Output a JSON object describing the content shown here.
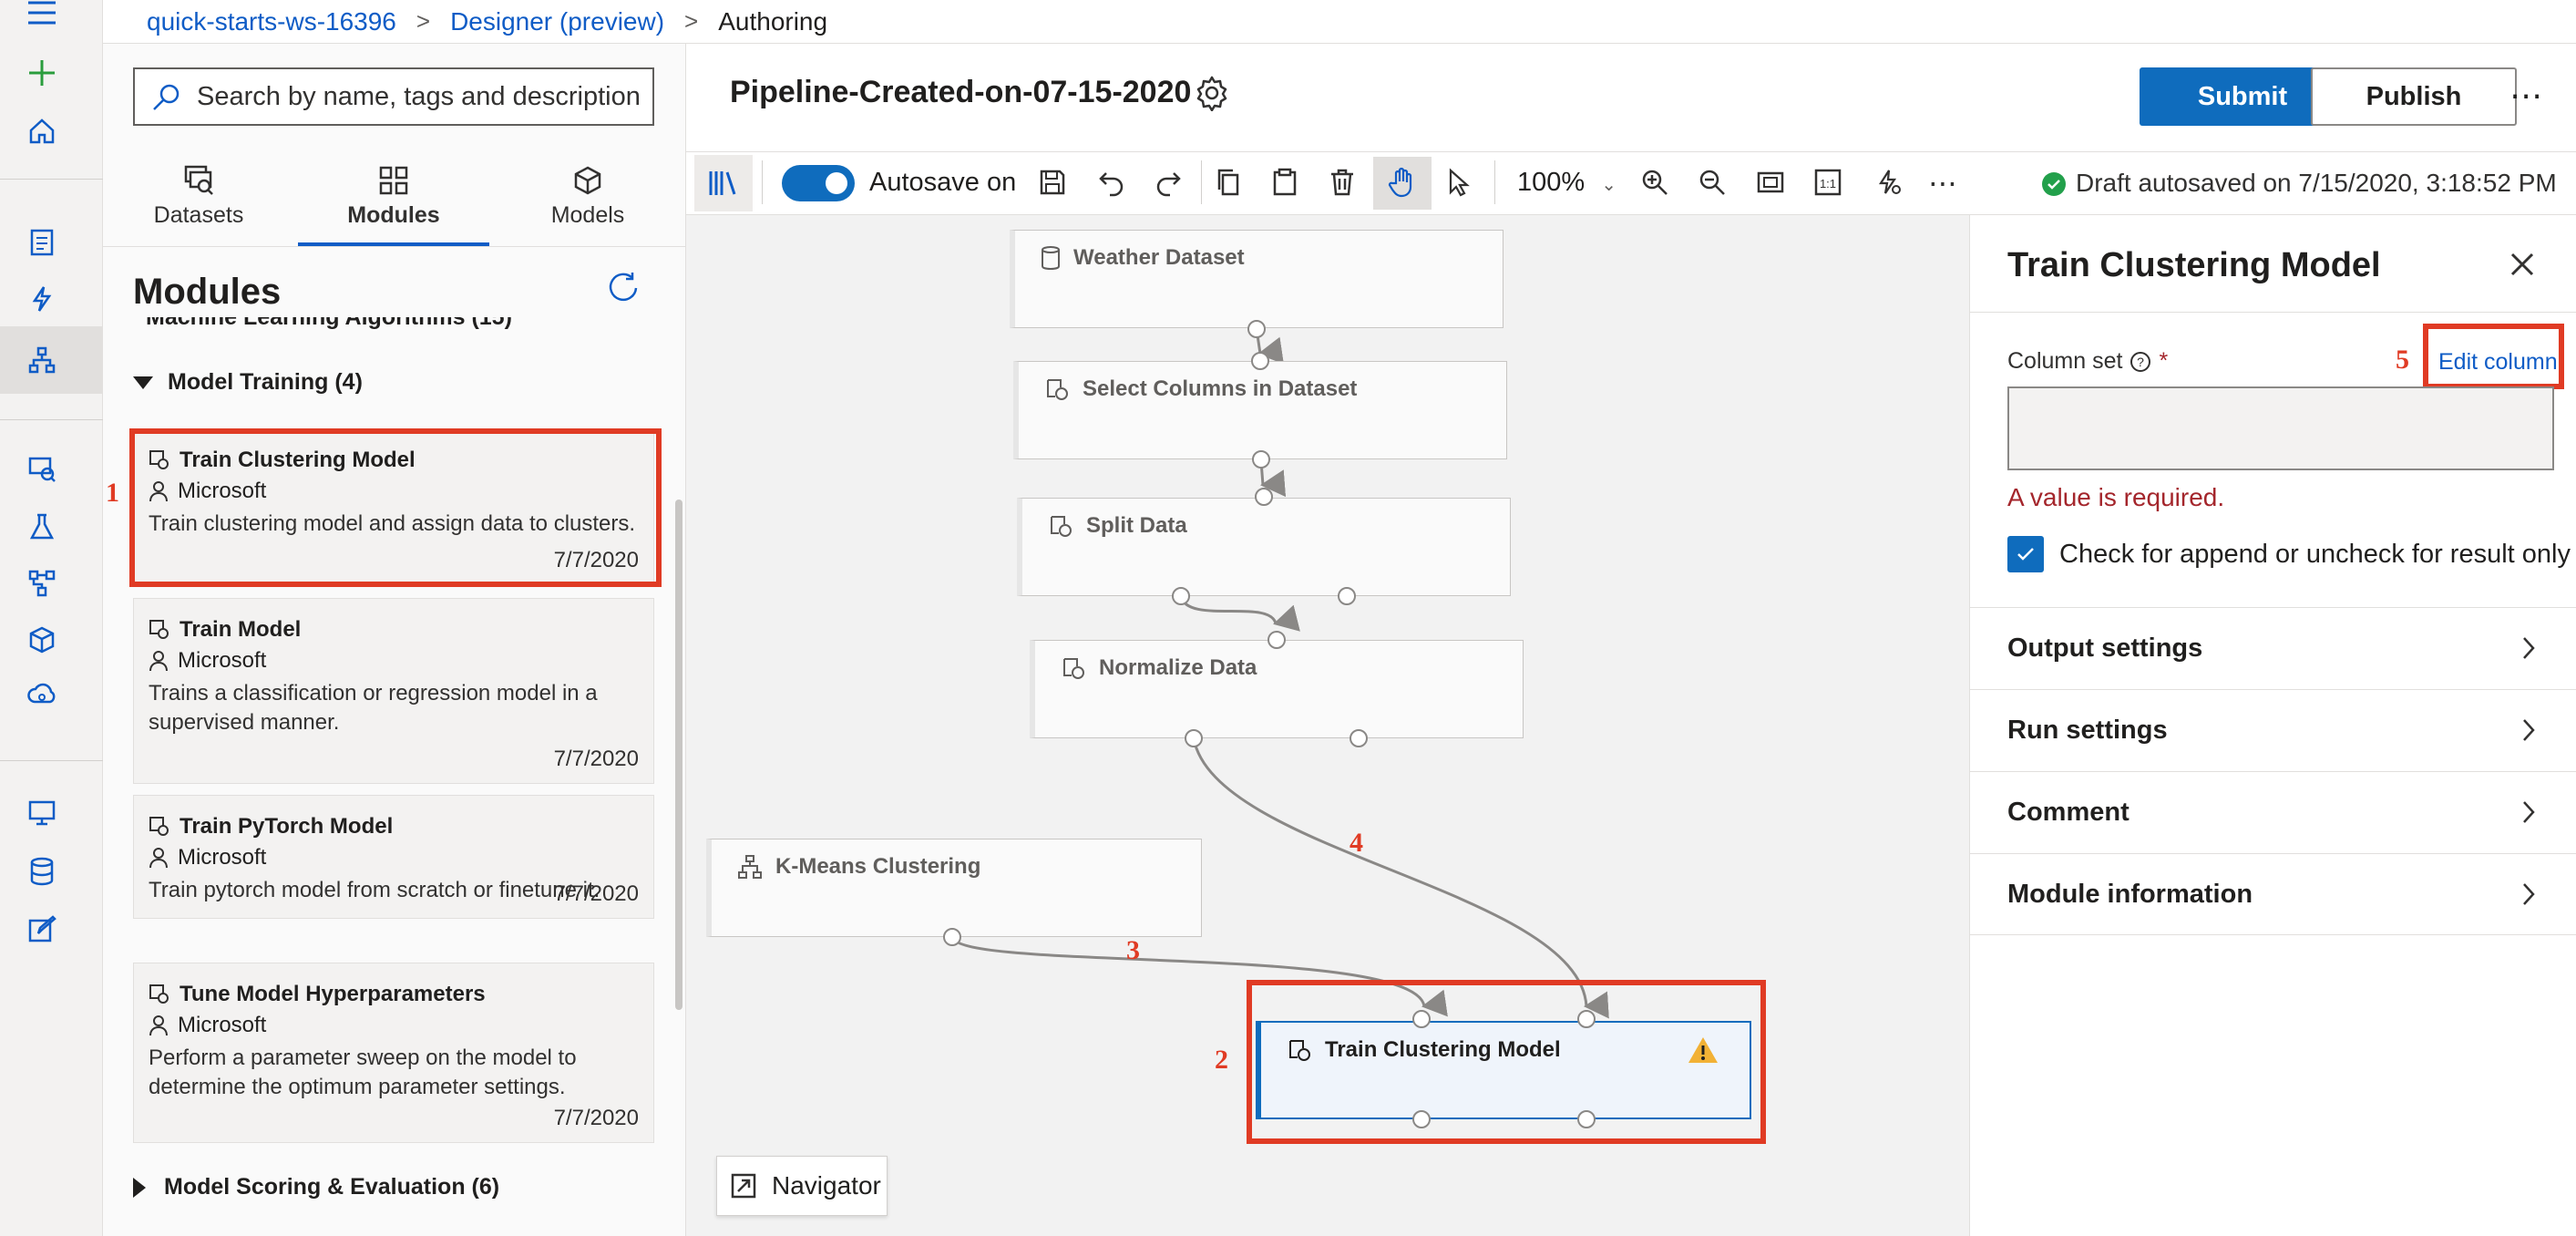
{
  "breadcrumb": {
    "workspace": "quick-starts-ws-16396",
    "designer": "Designer (preview)",
    "current": "Authoring"
  },
  "search": {
    "placeholder": "Search by name, tags and description"
  },
  "panel_tabs": [
    {
      "label": "Datasets",
      "icon": "datasets-icon",
      "selected": false
    },
    {
      "label": "Modules",
      "icon": "modules-icon",
      "selected": true
    },
    {
      "label": "Models",
      "icon": "models-icon",
      "selected": false
    }
  ],
  "modules": {
    "title": "Modules",
    "collapsed_row": "Machine Learning Algorithms (15)",
    "group": "Model Training (4)",
    "cards": [
      {
        "title": "Train Clustering Model",
        "author": "Microsoft",
        "description": "Train clustering model and assign data to clusters.",
        "date": "7/7/2020"
      },
      {
        "title": "Train Model",
        "author": "Microsoft",
        "description": "Trains a classification or regression model in a supervised manner.",
        "date": "7/7/2020"
      },
      {
        "title": "Train PyTorch Model",
        "author": "Microsoft",
        "description": "Train pytorch model from scratch or finetune it.",
        "date": "7/7/2020"
      },
      {
        "title": "Tune Model Hyperparameters",
        "author": "Microsoft",
        "description": "Perform a parameter sweep on the model to determine the optimum parameter settings.",
        "date": "7/7/2020"
      }
    ],
    "next_group": "Model Scoring & Evaluation (6)"
  },
  "header": {
    "pipeline_name": "Pipeline-Created-on-07-15-2020",
    "submit_label": "Submit",
    "publish_label": "Publish",
    "more_label": "⋯"
  },
  "toolbar": {
    "autosave_label": "Autosave on",
    "autosave_on": true,
    "zoom": "100%",
    "more_label": "⋯",
    "draft_status": "Draft autosaved on 7/15/2020, 3:18:52 PM"
  },
  "canvas": {
    "nodes": [
      {
        "name": "Weather Dataset",
        "icon": "dataset-icon"
      },
      {
        "name": "Select Columns in Dataset",
        "icon": "module-icon"
      },
      {
        "name": "Split Data",
        "icon": "module-icon"
      },
      {
        "name": "Normalize Data",
        "icon": "module-icon"
      },
      {
        "name": "K-Means Clustering",
        "icon": "algorithm-icon"
      },
      {
        "name": "Train Clustering Model",
        "icon": "module-icon",
        "warning": true
      }
    ],
    "navigator_label": "Navigator"
  },
  "annotations": [
    "1",
    "2",
    "3",
    "4",
    "5"
  ],
  "right_panel": {
    "title": "Train Clustering Model",
    "column_set_label": "Column set",
    "required_mark": "*",
    "edit_column_label": "Edit column",
    "column_set_value": "",
    "error": "A value is required.",
    "checkbox_label": "Check for append or uncheck for result only",
    "checkbox_checked": true,
    "sections": [
      "Output settings",
      "Run settings",
      "Comment",
      "Module information"
    ]
  },
  "colors": {
    "accent": "#0f6cbd",
    "link": "#0f5cc6",
    "annotation": "#e03b24",
    "error": "#a4262c",
    "warning": "#f2b135",
    "success": "#22a04b"
  }
}
